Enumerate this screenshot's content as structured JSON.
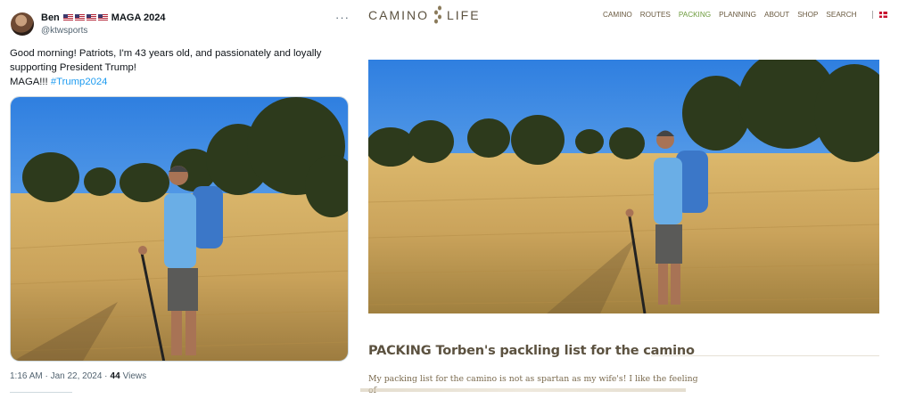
{
  "tweet": {
    "author_name": "Ben",
    "flag_count": 4,
    "author_suffix": "MAGA 2024",
    "handle": "@ktwsports",
    "more_label": "···",
    "text_line1": "Good morning! Patriots, I'm 43 years old, and passionately and loyally supporting President Trump!",
    "text_line2_prefix": "MAGA!!! ",
    "hashtag": "#Trump2024",
    "time": "1:16 AM · Jan 22, 2024 · ",
    "views_count": "44",
    "views_label": "Views"
  },
  "site": {
    "logo_left": "CAMINO",
    "logo_right": "LIFE",
    "nav": [
      "CAMINO",
      "ROUTES",
      "PACKING",
      "PLANNING",
      "ABOUT",
      "SHOP",
      "SEARCH"
    ],
    "active_nav": "PACKING",
    "heading_strong": "PACKING",
    "heading_rest": "Torben's packling list for the camino",
    "paragraph": "My packing list for the camino is not as spartan as my wife's! I like the feeling of"
  },
  "colors": {
    "link_blue": "#1d9bf0",
    "nav_active": "#6d9b3d",
    "nav_text": "#6a5a40",
    "heading": "#5c5240"
  },
  "icons": [
    "avatar",
    "usa-flag-icon",
    "more-icon",
    "camino-logo-icon",
    "danish-flag-icon"
  ]
}
